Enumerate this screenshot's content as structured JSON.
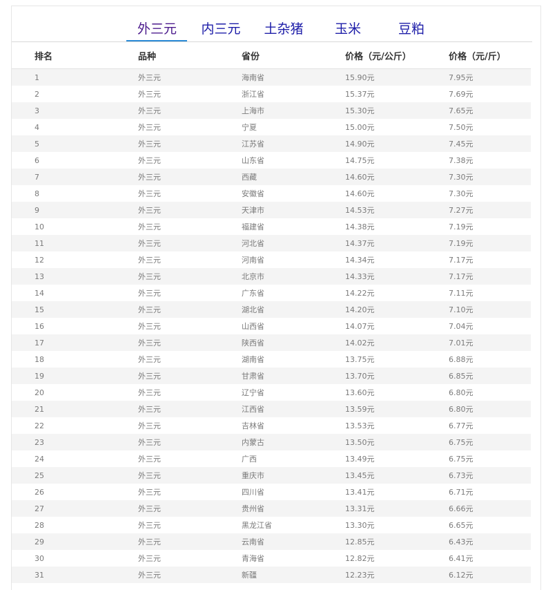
{
  "tabs": [
    {
      "label": "外三元",
      "active": true
    },
    {
      "label": "内三元",
      "active": false
    },
    {
      "label": "土杂猪",
      "active": false
    },
    {
      "label": "玉米",
      "active": false
    },
    {
      "label": "豆粕",
      "active": false
    }
  ],
  "table": {
    "headers": [
      "排名",
      "品种",
      "省份",
      "价格（元/公斤）",
      "价格（元/斤）"
    ],
    "rows": [
      [
        "1",
        "外三元",
        "海南省",
        "15.90元",
        "7.95元"
      ],
      [
        "2",
        "外三元",
        "浙江省",
        "15.37元",
        "7.69元"
      ],
      [
        "3",
        "外三元",
        "上海市",
        "15.30元",
        "7.65元"
      ],
      [
        "4",
        "外三元",
        "宁夏",
        "15.00元",
        "7.50元"
      ],
      [
        "5",
        "外三元",
        "江苏省",
        "14.90元",
        "7.45元"
      ],
      [
        "6",
        "外三元",
        "山东省",
        "14.75元",
        "7.38元"
      ],
      [
        "7",
        "外三元",
        "西藏",
        "14.60元",
        "7.30元"
      ],
      [
        "8",
        "外三元",
        "安徽省",
        "14.60元",
        "7.30元"
      ],
      [
        "9",
        "外三元",
        "天津市",
        "14.53元",
        "7.27元"
      ],
      [
        "10",
        "外三元",
        "福建省",
        "14.38元",
        "7.19元"
      ],
      [
        "11",
        "外三元",
        "河北省",
        "14.37元",
        "7.19元"
      ],
      [
        "12",
        "外三元",
        "河南省",
        "14.34元",
        "7.17元"
      ],
      [
        "13",
        "外三元",
        "北京市",
        "14.33元",
        "7.17元"
      ],
      [
        "14",
        "外三元",
        "广东省",
        "14.22元",
        "7.11元"
      ],
      [
        "15",
        "外三元",
        "湖北省",
        "14.20元",
        "7.10元"
      ],
      [
        "16",
        "外三元",
        "山西省",
        "14.07元",
        "7.04元"
      ],
      [
        "17",
        "外三元",
        "陕西省",
        "14.02元",
        "7.01元"
      ],
      [
        "18",
        "外三元",
        "湖南省",
        "13.75元",
        "6.88元"
      ],
      [
        "19",
        "外三元",
        "甘肃省",
        "13.70元",
        "6.85元"
      ],
      [
        "20",
        "外三元",
        "辽宁省",
        "13.60元",
        "6.80元"
      ],
      [
        "21",
        "外三元",
        "江西省",
        "13.59元",
        "6.80元"
      ],
      [
        "22",
        "外三元",
        "吉林省",
        "13.53元",
        "6.77元"
      ],
      [
        "23",
        "外三元",
        "内蒙古",
        "13.50元",
        "6.75元"
      ],
      [
        "24",
        "外三元",
        "广西",
        "13.49元",
        "6.75元"
      ],
      [
        "25",
        "外三元",
        "重庆市",
        "13.45元",
        "6.73元"
      ],
      [
        "26",
        "外三元",
        "四川省",
        "13.41元",
        "6.71元"
      ],
      [
        "27",
        "外三元",
        "贵州省",
        "13.31元",
        "6.66元"
      ],
      [
        "28",
        "外三元",
        "黑龙江省",
        "13.30元",
        "6.65元"
      ],
      [
        "29",
        "外三元",
        "云南省",
        "12.85元",
        "6.43元"
      ],
      [
        "30",
        "外三元",
        "青海省",
        "12.82元",
        "6.41元"
      ],
      [
        "31",
        "外三元",
        "新疆",
        "12.23元",
        "6.12元"
      ]
    ]
  }
}
